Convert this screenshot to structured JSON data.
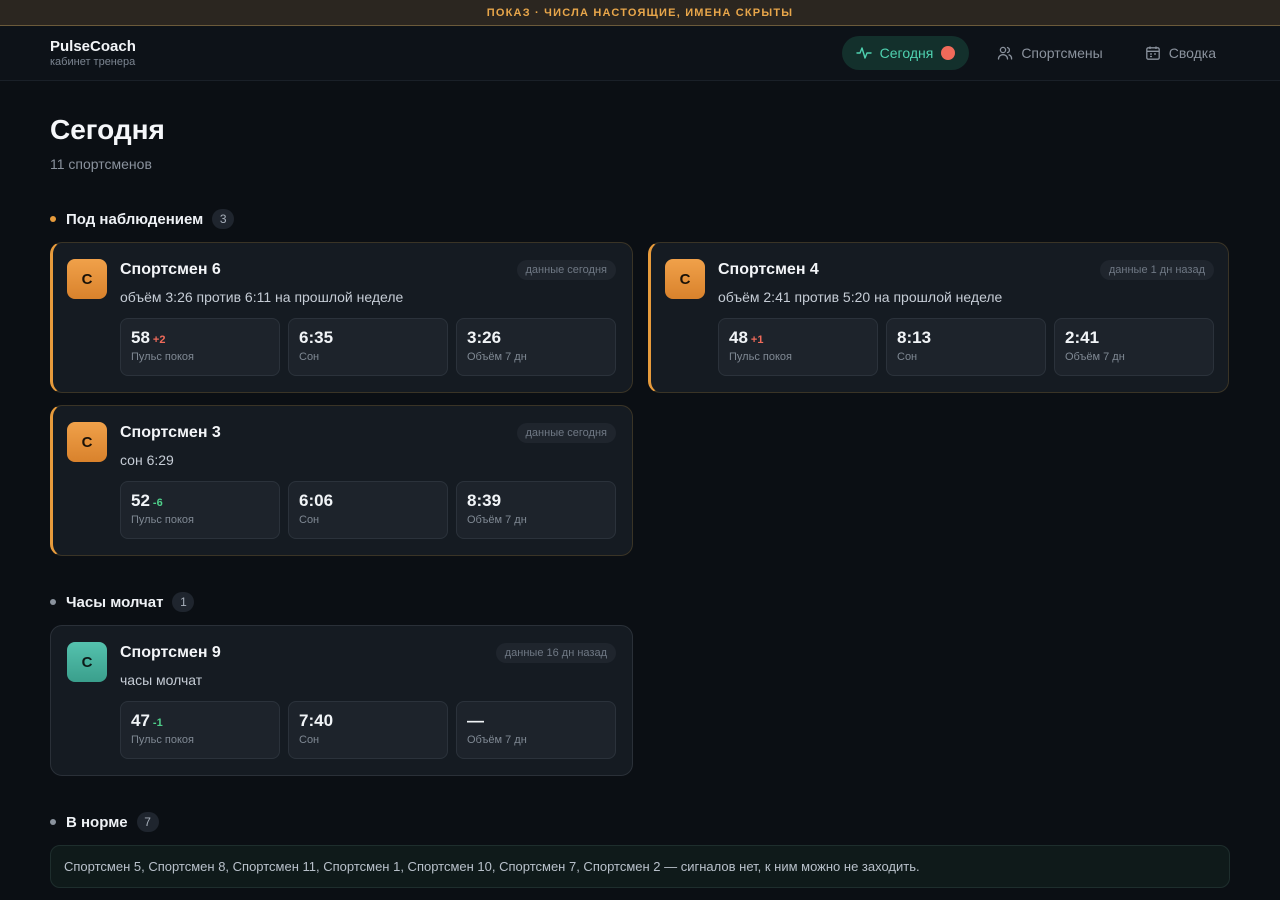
{
  "banner": "ПОКАЗ · ЧИСЛА НАСТОЯЩИЕ, ИМЕНА СКРЫТЫ",
  "brand": {
    "name": "PulseCoach",
    "sub": "кабинет тренера"
  },
  "nav": [
    {
      "label": "Сегодня",
      "icon": "pulse-icon"
    },
    {
      "label": "Спортсмены",
      "icon": "users-icon"
    },
    {
      "label": "Сводка",
      "icon": "calendar-icon"
    }
  ],
  "page": {
    "title": "Сегодня",
    "subtitle": "11 спортсменов"
  },
  "colors": {
    "watch": "#e79b3c",
    "silent": "#8a929d",
    "normal": "#8a929d",
    "accent": "#4fd1b0",
    "alert": "#f06a5a"
  },
  "sections": {
    "watch": {
      "title": "Под наблюдением",
      "count": "3",
      "cards": [
        {
          "initial": "С",
          "name": "Спортсмен 6",
          "freshness": "данные сегодня",
          "note": "объём 3:26 против 6:11 на прошлой неделе",
          "metrics": [
            {
              "value": "58",
              "delta": "+2",
              "label": "Пульс покоя"
            },
            {
              "value": "6:35",
              "delta": "",
              "label": "Сон"
            },
            {
              "value": "3:26",
              "delta": "",
              "label": "Объём 7 дн"
            }
          ]
        },
        {
          "initial": "С",
          "name": "Спортсмен 4",
          "freshness": "данные 1 дн назад",
          "note": "объём 2:41 против 5:20 на прошлой неделе",
          "metrics": [
            {
              "value": "48",
              "delta": "+1",
              "label": "Пульс покоя"
            },
            {
              "value": "8:13",
              "delta": "",
              "label": "Сон"
            },
            {
              "value": "2:41",
              "delta": "",
              "label": "Объём 7 дн"
            }
          ]
        },
        {
          "initial": "С",
          "name": "Спортсмен 3",
          "freshness": "данные сегодня",
          "note": "сон 6:29",
          "metrics": [
            {
              "value": "52",
              "delta": "-6",
              "label": "Пульс покоя"
            },
            {
              "value": "6:06",
              "delta": "",
              "label": "Сон"
            },
            {
              "value": "8:39",
              "delta": "",
              "label": "Объём 7 дн"
            }
          ]
        }
      ]
    },
    "silent": {
      "title": "Часы молчат",
      "count": "1",
      "cards": [
        {
          "initial": "С",
          "name": "Спортсмен 9",
          "freshness": "данные 16 дн назад",
          "note": "часы молчат",
          "metrics": [
            {
              "value": "47",
              "delta": "-1",
              "label": "Пульс покоя"
            },
            {
              "value": "7:40",
              "delta": "",
              "label": "Сон"
            },
            {
              "value": "—",
              "delta": "",
              "label": "Объём 7 дн"
            }
          ]
        }
      ]
    },
    "normal": {
      "title": "В норме",
      "count": "7",
      "text": "Спортсмен 5, Спортсмен 8, Спортсмен 11, Спортсмен 1, Спортсмен 10, Спортсмен 7, Спортсмен 2 — сигналов нет, к ним можно не заходить."
    }
  }
}
